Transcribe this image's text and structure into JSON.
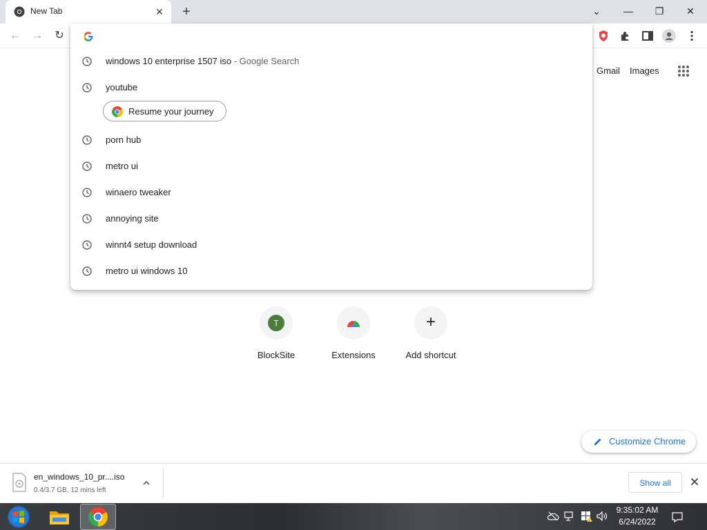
{
  "tab": {
    "title": "New Tab",
    "close": "✕",
    "new_tab": "+"
  },
  "window_controls": {
    "dropdown": "⌄",
    "minimize": "—",
    "restore": "❐",
    "close": "✕"
  },
  "toolbar": {
    "back": "←",
    "forward": "→",
    "reload": "↻"
  },
  "header_links": {
    "gmail": "Gmail",
    "images": "Images"
  },
  "omnibox": {
    "suggestions": [
      {
        "text": "windows 10 enterprise 1507 iso",
        "sep": " - ",
        "suffix": "Google Search"
      },
      {
        "text": "youtube",
        "sep": "",
        "suffix": ""
      },
      {
        "text": "porn hub",
        "sep": "",
        "suffix": ""
      },
      {
        "text": "metro ui",
        "sep": "",
        "suffix": ""
      },
      {
        "text": "winaero tweaker",
        "sep": "",
        "suffix": ""
      },
      {
        "text": "annoying site",
        "sep": "",
        "suffix": ""
      },
      {
        "text": "winnt4 setup download",
        "sep": "",
        "suffix": ""
      },
      {
        "text": "metro ui windows 10",
        "sep": "",
        "suffix": ""
      }
    ],
    "resume_chip": "Resume your journey"
  },
  "shortcuts": [
    {
      "label": "BlockSite",
      "initial": "T"
    },
    {
      "label": "Extensions"
    },
    {
      "label": "Add shortcut",
      "symbol": "+"
    }
  ],
  "customize": {
    "label": "Customize Chrome"
  },
  "download": {
    "filename": "en_windows_10_pr....iso",
    "status": "0.4/3.7 GB, 12 mins left",
    "show_all": "Show all"
  },
  "taskbar": {
    "time": "9:35:02 AM",
    "date": "6/24/2022"
  },
  "colors": {
    "tabstrip": "#dee1e6",
    "accent": "#1a73e8",
    "avatar_green": "#4e7c3a"
  }
}
